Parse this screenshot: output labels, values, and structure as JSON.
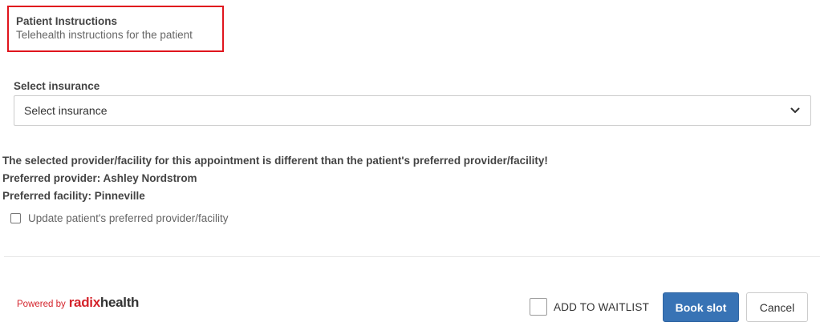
{
  "instructions": {
    "title": "Patient Instructions",
    "subtitle": "Telehealth instructions for the patient"
  },
  "insurance": {
    "label": "Select insurance",
    "selected": "Select insurance"
  },
  "warning": {
    "message": "The selected provider/facility for this appointment is different than the patient's preferred provider/facility!",
    "preferred_provider": "Preferred provider: Ashley Nordstrom",
    "preferred_facility": "Preferred facility: Pinneville"
  },
  "update_preferred": {
    "label": "Update patient's preferred provider/facility",
    "checked": false
  },
  "footer": {
    "powered_by": "Powered by",
    "brand_part1": "radix",
    "brand_part2": "health",
    "waitlist_label": "ADD TO WAITLIST",
    "book_label": "Book slot",
    "cancel_label": "Cancel"
  },
  "colors": {
    "highlight_border": "#e0151d",
    "primary_button": "#3873b5",
    "brand_red": "#d4232b"
  },
  "icons": {
    "select_chevron": "chevron-down-icon"
  }
}
